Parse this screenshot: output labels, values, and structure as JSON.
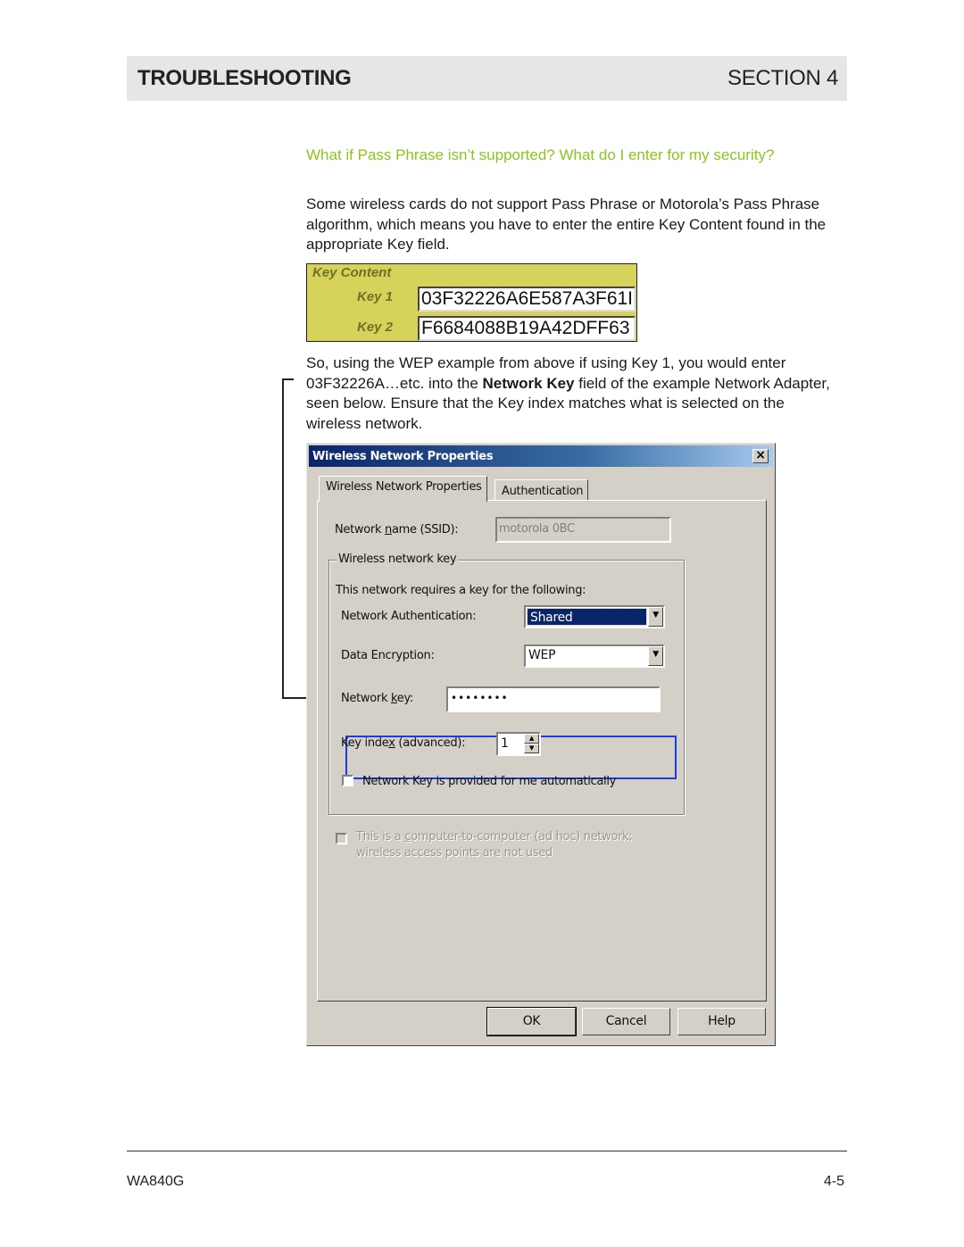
{
  "header": {
    "title": "TROUBLESHOOTING",
    "section": "SECTION 4"
  },
  "question": "What if Pass Phrase isn’t supported? What do I enter for my security?",
  "paragraph1": "Some wireless cards do not support Pass Phrase or Motorola’s Pass Phrase algorithm, which means you have to enter the entire Key Content found in the appropriate Key field.",
  "key_content": {
    "title": "Key Content",
    "keys": [
      {
        "label": "Key 1",
        "value": "03F32226A6E587A3F61I"
      },
      {
        "label": "Key 2",
        "value": "F6684088B19A42DFF63"
      }
    ],
    "background_color": "#d7d35a"
  },
  "paragraph2": {
    "before": "So, using the WEP example from above if using Key 1, you would enter 03F32226A…etc. into the ",
    "bold": "Network Key",
    "after": " field of the example Network Adapter, seen below. Ensure that the Key index matches what is selected on the wireless network."
  },
  "dialog": {
    "title": "Wireless Network Properties",
    "close_icon": "close-x-icon",
    "tabs": [
      {
        "label": "Wireless Network Properties",
        "active": true
      },
      {
        "label": "Authentication",
        "active": false
      }
    ],
    "ssid": {
      "label_pre": "Network ",
      "label_u": "n",
      "label_post": "ame (SSID):",
      "value": "motorola 0BC"
    },
    "group_title": "Wireless network key",
    "requires_text": "This network requires a key for the following:",
    "network_auth": {
      "label": "Network Authentication:",
      "value": "Shared"
    },
    "data_encryption": {
      "label": "Data Encryption:",
      "value": "WEP"
    },
    "network_key": {
      "label_pre": "Network ",
      "label_u": "k",
      "label_post": "ey:",
      "value": "••••••••"
    },
    "key_index": {
      "label_pre": "Key inde",
      "label_u": "x",
      "label_post": " (advanced):",
      "value": "1"
    },
    "auto_key_checkbox": {
      "label": "Network Key is provided for me automatically",
      "checked": false
    },
    "adhoc_checkbox": {
      "line1_pre": "This is a ",
      "line1_u": "c",
      "line1_post": "omputer-to-computer (ad hoc) network;",
      "line2": "wireless access points are not used",
      "checked": false,
      "disabled": true
    },
    "buttons": {
      "ok": "OK",
      "cancel": "Cancel",
      "help": "Help"
    },
    "highlight_color": "#1a3ce8"
  },
  "footer": {
    "model": "WA840G",
    "page": "4-5"
  },
  "colors": {
    "question_green": "#8ec31e",
    "header_bg": "#e6e6e6",
    "titlebar_start": "#0a246a",
    "dialog_face": "#d4d0c8"
  }
}
